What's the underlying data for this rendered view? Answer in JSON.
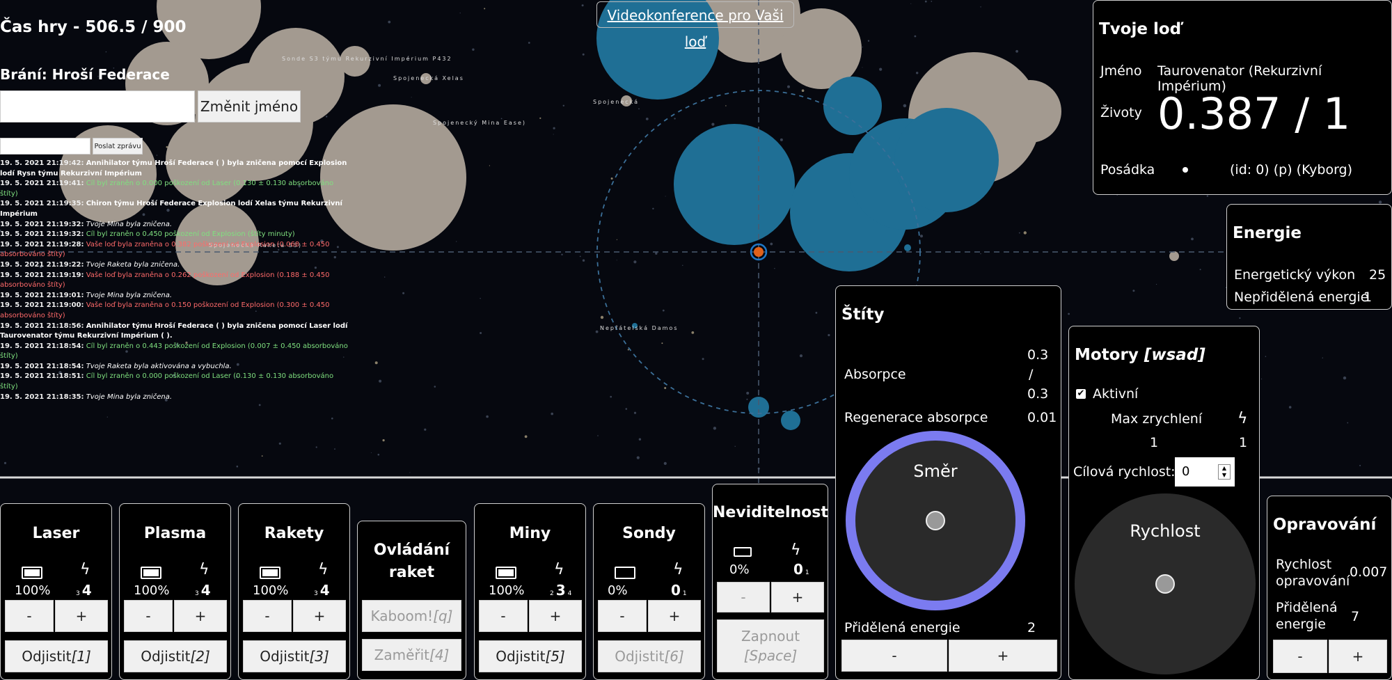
{
  "hud": {
    "game_time": "Čas hry - 506.5 / 900",
    "guarding": "Brání: Hroší Federace",
    "rename_button": "Změnit jméno",
    "message_button": "Poslat zprávu",
    "video_link": "Videokonference pro Vaši loď"
  },
  "log": [
    {
      "t": "19. 5. 2021 21:19:42:",
      "m": "Annihilator týmu Hroší Federace (           ) byla zničena pomocí Explosion lodí Rysn týmu Rekurzivní Impérium",
      "c": "#ffffff",
      "bold": true
    },
    {
      "t": "19. 5. 2021 21:19:41:",
      "m": "Cíl byl zraněn o 0.000 poškození od Laser (0.130 ± 0.130 absorbováno štíty)",
      "c": "#7fe07f",
      "bold": false
    },
    {
      "t": "19. 5. 2021 21:19:35:",
      "m": "Chiron týmu Hroší Federace Explosion lodí Xelas týmu Rekurzivní Impérium",
      "c": "#ffffff",
      "bold": true
    },
    {
      "t": "19. 5. 2021 21:19:32:",
      "m": "Tvoje Mina byla zničena.",
      "c": "#ffffff",
      "bold": false,
      "it": true
    },
    {
      "t": "19. 5. 2021 21:19:32:",
      "m": "Cíl byl zraněn o 0.450 poškození od Explosion (štíty minuty)",
      "c": "#7fe07f",
      "bold": false
    },
    {
      "t": "19. 5. 2021 21:19:28:",
      "m": "Vaše loď byla zraněna o 0.382 poškození od Explosion (0.068 ± 0.450 absorbováno štíty)",
      "c": "#ff6a6a",
      "bold": false
    },
    {
      "t": "19. 5. 2021 21:19:22:",
      "m": "Tvoje Raketa byla zničena.",
      "c": "#ffffff",
      "bold": false,
      "it": true
    },
    {
      "t": "19. 5. 2021 21:19:19:",
      "m": "Vaše loď byla zraněna o 0.262 poškození od Explosion (0.188 ± 0.450 absorbováno štíty)",
      "c": "#ff6a6a",
      "bold": false
    },
    {
      "t": "19. 5. 2021 21:19:01:",
      "m": "Tvoje Mina byla zničena.",
      "c": "#ffffff",
      "bold": false,
      "it": true
    },
    {
      "t": "19. 5. 2021 21:19:00:",
      "m": "Vaše loď byla zraněna o 0.150 poškození od Explosion (0.300 ± 0.450 absorbováno štíty)",
      "c": "#ff6a6a",
      "bold": false
    },
    {
      "t": "19. 5. 2021 21:18:56:",
      "m": "Annihilator týmu Hroší Federace (           ) byla zničena pomocí Laser lodí Taurovenator týmu Rekurzivní Impérium (       ).",
      "c": "#ffffff",
      "bold": true
    },
    {
      "t": "19. 5. 2021 21:18:54:",
      "m": "Cíl byl zraněn o 0.443 poškození od Explosion (0.007 ± 0.450 absorbováno štíty)",
      "c": "#7fe07f",
      "bold": false
    },
    {
      "t": "19. 5. 2021 21:18:54:",
      "m": "Tvoje Raketa byla aktivována a vybuchla.",
      "c": "#ffffff",
      "bold": false,
      "it": true
    },
    {
      "t": "19. 5. 2021 21:18:51:",
      "m": "Cíl byl zraněn o 0.000 poškození od Laser (0.130 ± 0.130 absorbováno štíty)",
      "c": "#7fe07f",
      "bold": false
    },
    {
      "t": "19. 5. 2021 21:18:35:",
      "m": "Tvoje Mina byla zničena.",
      "c": "#ffffff",
      "bold": false,
      "it": true
    }
  ],
  "radar_labels": [
    "Sonde S3 týmu Rekurzivní Impérium P432",
    "Spojenecká Xelas",
    "Spojenecká",
    "Spojenecký Mina Ease)",
    "Spojenecká Raketa S3)",
    "Nepřátelská Damos"
  ],
  "ship": {
    "title": "Tvoje loď",
    "name_label": "Jméno",
    "name_value": "Taurovenator (Rekurzivní Impérium)",
    "hp_label": "Životy",
    "hp_value": "0.387 / 1",
    "crew_label": "Posádka",
    "crew_value": "(id: 0) (p) (Kyborg)"
  },
  "energy": {
    "title": "Energie",
    "output_label": "Energetický výkon",
    "output_value": "25",
    "free_label": "Nepřidělená energie",
    "free_value": "1"
  },
  "shields": {
    "title": "Štíty",
    "abs_label": "Absorpce",
    "abs_cur": "0.3",
    "abs_sep": "/",
    "abs_max": "0.3",
    "regen_label": "Regenerace absorpce",
    "regen_value": "0.01",
    "dial_label": "Směr",
    "energy_label": "Přidělená energie",
    "energy_value": "2",
    "minus": "-",
    "plus": "+"
  },
  "engines": {
    "title": "Motory",
    "hotkey": "[wsad]",
    "active_label": "Aktivní",
    "accel_label": "Max zrychlení",
    "accel_value": "1",
    "energy_value": "1",
    "target_label": "Cílová rychlost:",
    "target_value": "0",
    "dial_label": "Rychlost"
  },
  "repair": {
    "title": "Opravování",
    "speed_label": "Rychlost opravování",
    "speed_value": "0.007",
    "energy_label": "Přidělená energie",
    "energy_value": "7",
    "minus": "-",
    "plus": "+"
  },
  "weapons": [
    {
      "title": "Laser",
      "charge": "100%",
      "energy": "4",
      "energy_sub": "3",
      "energy_max": "",
      "minus": "-",
      "plus": "+",
      "fire": "Odjistit ",
      "key": "[1]",
      "fire_disabled": false,
      "battery": "full"
    },
    {
      "title": "Plasma",
      "charge": "100%",
      "energy": "4",
      "energy_sub": "3",
      "energy_max": "",
      "minus": "-",
      "plus": "+",
      "fire": "Odjistit ",
      "key": "[2]",
      "fire_disabled": false,
      "battery": "full"
    },
    {
      "title": "Rakety",
      "charge": "100%",
      "energy": "4",
      "energy_sub": "3",
      "energy_max": "",
      "minus": "-",
      "plus": "+",
      "fire": "Odjistit ",
      "key": "[3]",
      "fire_disabled": false,
      "battery": "full"
    },
    {
      "title": "Miny",
      "charge": "100%",
      "energy": "3",
      "energy_sub": "2",
      "energy_max": "4",
      "minus": "-",
      "plus": "+",
      "fire": "Odjistit ",
      "key": "[5]",
      "fire_disabled": false,
      "battery": "full"
    },
    {
      "title": "Sondy",
      "charge": "0%",
      "energy": "0",
      "energy_sub": "",
      "energy_max": "1",
      "minus": "-",
      "plus": "+",
      "fire": "Odjistit ",
      "key": "[6]",
      "fire_disabled": true,
      "battery": "empty"
    }
  ],
  "missile_ctrl": {
    "title": "Ovládání raket",
    "kaboom": "Kaboom! ",
    "kaboom_key": "[q]",
    "aim": "Zaměřit ",
    "aim_key": "[4]"
  },
  "stealth": {
    "title": "Neviditelnost",
    "charge": "0%",
    "energy": "0",
    "energy_max": "1",
    "minus": "-",
    "plus": "+",
    "toggle": "Zapnout",
    "toggle_key": "[Space]"
  }
}
